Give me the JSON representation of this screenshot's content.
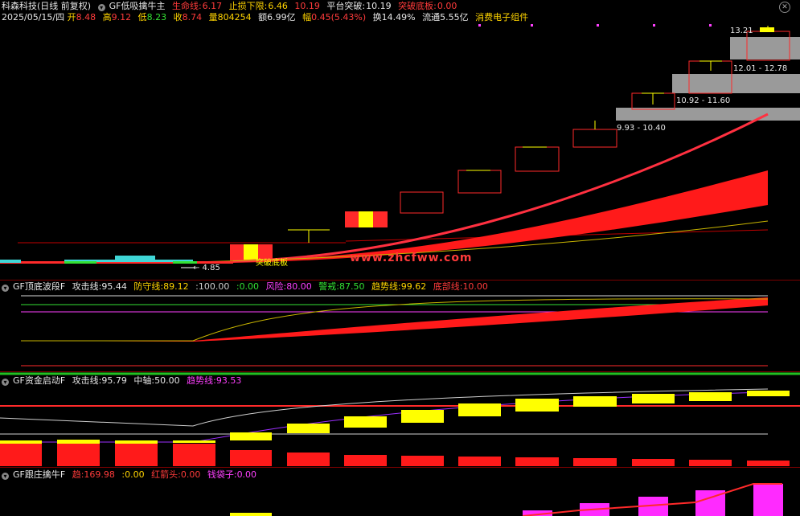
{
  "stock": {
    "title": "科森科技(日线 前复权)",
    "indicator": "GF低吸擒牛主",
    "lifeline_label": "生命线:",
    "lifeline": "6.17",
    "stoploss_label": "止损下限:",
    "stoploss": "6.46",
    "stop_extra": "10.19",
    "platform_label": "平台突破:",
    "platform": "10.19",
    "breakout_label": "突破底板:",
    "breakout": "0.00"
  },
  "info": {
    "date": "2025/05/15/四",
    "open_label": "开",
    "open": "8.48",
    "high_label": "高",
    "high": "9.12",
    "low_label": "低",
    "low": "8.23",
    "close_label": "收",
    "close": "8.74",
    "vol_label": "量",
    "vol": "804254",
    "amt_label": "额",
    "amt": "6.99亿",
    "chg_label": "幅",
    "chg": "0.45(5.43%)",
    "turn_label": "换",
    "turn": "14.49%",
    "float_label": "流通",
    "float": "5.55亿",
    "sector": "消费电子组件"
  },
  "zones": [
    {
      "label": "13.21"
    },
    {
      "label": "12.01 - 12.78"
    },
    {
      "label": "10.92 - 11.60"
    },
    {
      "label": "9.93 - 10.40"
    }
  ],
  "low_marker": "← 4.85",
  "annot1": "突破底板",
  "watermark": "www.zhcfww.com",
  "panel1": {
    "name": "GF顶底波段F",
    "attack_label": "攻击线:",
    "attack": "95.44",
    "defend_label": "防守线:",
    "defend": "89.12",
    "v100": "100.00",
    "v0": "0.00",
    "risk_label": "风险:",
    "risk": "80.00",
    "alert_label": "警戒:",
    "alert": "87.50",
    "trend_label": "趋势线:",
    "trend": "99.62",
    "bottom_label": "底部线:",
    "bottom": "10.00"
  },
  "panel2": {
    "name": "GF资金启动F",
    "attack_label": "攻击线:",
    "attack": "95.79",
    "mid_label": "中轴:",
    "mid": "50.00",
    "trend_label": "趋势线:",
    "trend": "93.53"
  },
  "panel3": {
    "name": "GF跟庄擒牛F",
    "a_label": "趋",
    "a": "169.98",
    "b": "0.00",
    "c_label": "红箭头:",
    "c": "0.00",
    "d_label": "钱袋子:",
    "d": "0.00"
  },
  "colors": {
    "up": "#ff2a2a",
    "down": "#ffff00",
    "accent": "#ff40ff",
    "cyan": "#3fd6d6"
  }
}
